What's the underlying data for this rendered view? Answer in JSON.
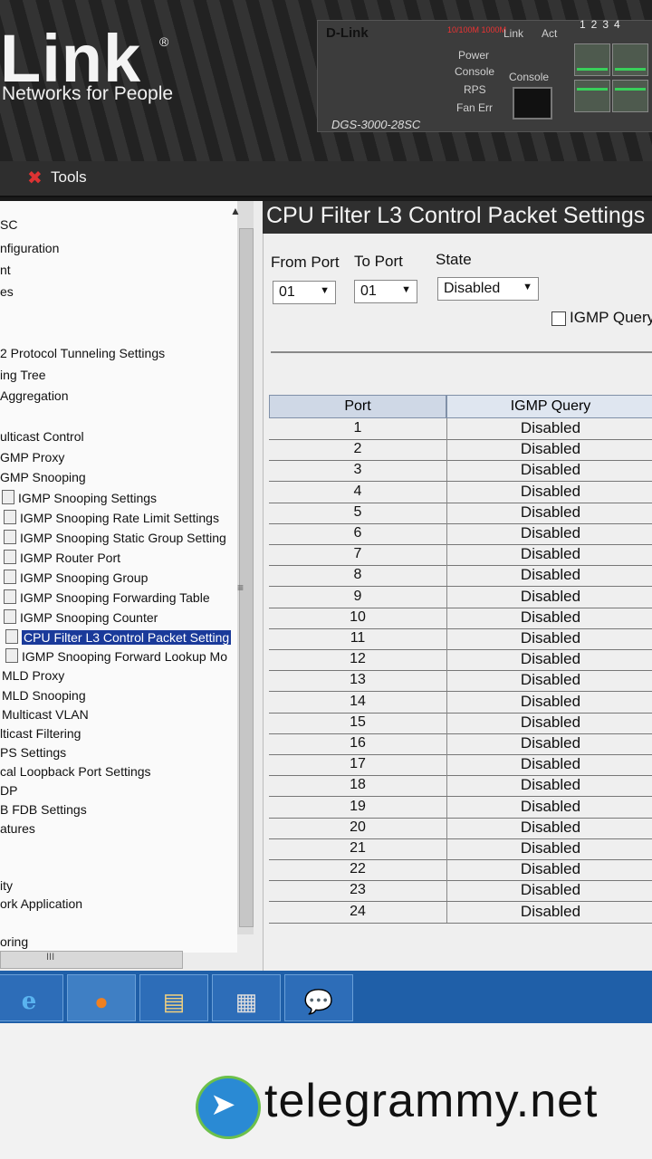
{
  "header": {
    "logo_text": "Link",
    "logo_reg": "®",
    "tagline": "Networks for People",
    "device": {
      "brand": "D-Link",
      "model": "DGS-3000-28SC",
      "speed_label": "10/100M 1000M",
      "link_label": "Link",
      "act_label": "Act",
      "power_label": "Power",
      "console_led_label": "Console",
      "rps_label": "RPS",
      "fan_label": "Fan Err",
      "console_label": "Console",
      "port_numbers": "1234"
    }
  },
  "toolbar": {
    "tools_label": "Tools"
  },
  "nav": {
    "items": [
      {
        "label": "SC"
      },
      {
        "label": "nfiguration"
      },
      {
        "label": "nt"
      },
      {
        "label": "es"
      },
      {
        "label": "2 Protocol Tunneling Settings"
      },
      {
        "label": "ing Tree"
      },
      {
        "label": "Aggregation"
      },
      {
        "label": "ulticast Control"
      },
      {
        "label": "GMP Proxy"
      },
      {
        "label": "GMP Snooping"
      },
      {
        "label": "IGMP Snooping Settings"
      },
      {
        "label": "IGMP Snooping Rate Limit Settings"
      },
      {
        "label": "IGMP Snooping Static Group Setting"
      },
      {
        "label": "IGMP Router Port"
      },
      {
        "label": "IGMP Snooping Group"
      },
      {
        "label": "IGMP Snooping Forwarding Table"
      },
      {
        "label": "IGMP Snooping Counter"
      },
      {
        "label": "CPU Filter L3 Control Packet Setting"
      },
      {
        "label": "IGMP Snooping Forward Lookup Mo"
      },
      {
        "label": "MLD Proxy"
      },
      {
        "label": "MLD Snooping"
      },
      {
        "label": "Multicast VLAN"
      },
      {
        "label": "lticast Filtering"
      },
      {
        "label": "PS Settings"
      },
      {
        "label": "cal Loopback Port Settings"
      },
      {
        "label": "DP"
      },
      {
        "label": "B FDB Settings"
      },
      {
        "label": "atures"
      },
      {
        "label": "ity"
      },
      {
        "label": "ork Application"
      },
      {
        "label": "oring"
      }
    ],
    "hscroll_grip": "III",
    "vscroll_grip": "≡"
  },
  "main": {
    "title": "CPU Filter L3 Control Packet Settings",
    "from_port_label": "From Port",
    "to_port_label": "To Port",
    "state_label": "State",
    "from_port_value": "01",
    "to_port_value": "01",
    "state_value": "Disabled",
    "igmp_query_label": "IGMP Query",
    "table": {
      "headers": [
        "Port",
        "IGMP Query"
      ],
      "rows": [
        [
          "1",
          "Disabled"
        ],
        [
          "2",
          "Disabled"
        ],
        [
          "3",
          "Disabled"
        ],
        [
          "4",
          "Disabled"
        ],
        [
          "5",
          "Disabled"
        ],
        [
          "6",
          "Disabled"
        ],
        [
          "7",
          "Disabled"
        ],
        [
          "8",
          "Disabled"
        ],
        [
          "9",
          "Disabled"
        ],
        [
          "10",
          "Disabled"
        ],
        [
          "11",
          "Disabled"
        ],
        [
          "12",
          "Disabled"
        ],
        [
          "13",
          "Disabled"
        ],
        [
          "14",
          "Disabled"
        ],
        [
          "15",
          "Disabled"
        ],
        [
          "16",
          "Disabled"
        ],
        [
          "17",
          "Disabled"
        ],
        [
          "18",
          "Disabled"
        ],
        [
          "19",
          "Disabled"
        ],
        [
          "20",
          "Disabled"
        ],
        [
          "21",
          "Disabled"
        ],
        [
          "22",
          "Disabled"
        ],
        [
          "23",
          "Disabled"
        ],
        [
          "24",
          "Disabled"
        ]
      ]
    }
  },
  "taskbar": {
    "apps": [
      {
        "icon": "internet-explorer-icon",
        "glyph": "e"
      },
      {
        "icon": "firefox-icon",
        "glyph": "●"
      },
      {
        "icon": "file-explorer-icon",
        "glyph": "▤"
      },
      {
        "icon": "calculator-icon",
        "glyph": "▦"
      },
      {
        "icon": "chat-icon",
        "glyph": "💬"
      }
    ]
  },
  "watermark": {
    "text": "telegrammy.net",
    "plane_glyph": "➤"
  }
}
